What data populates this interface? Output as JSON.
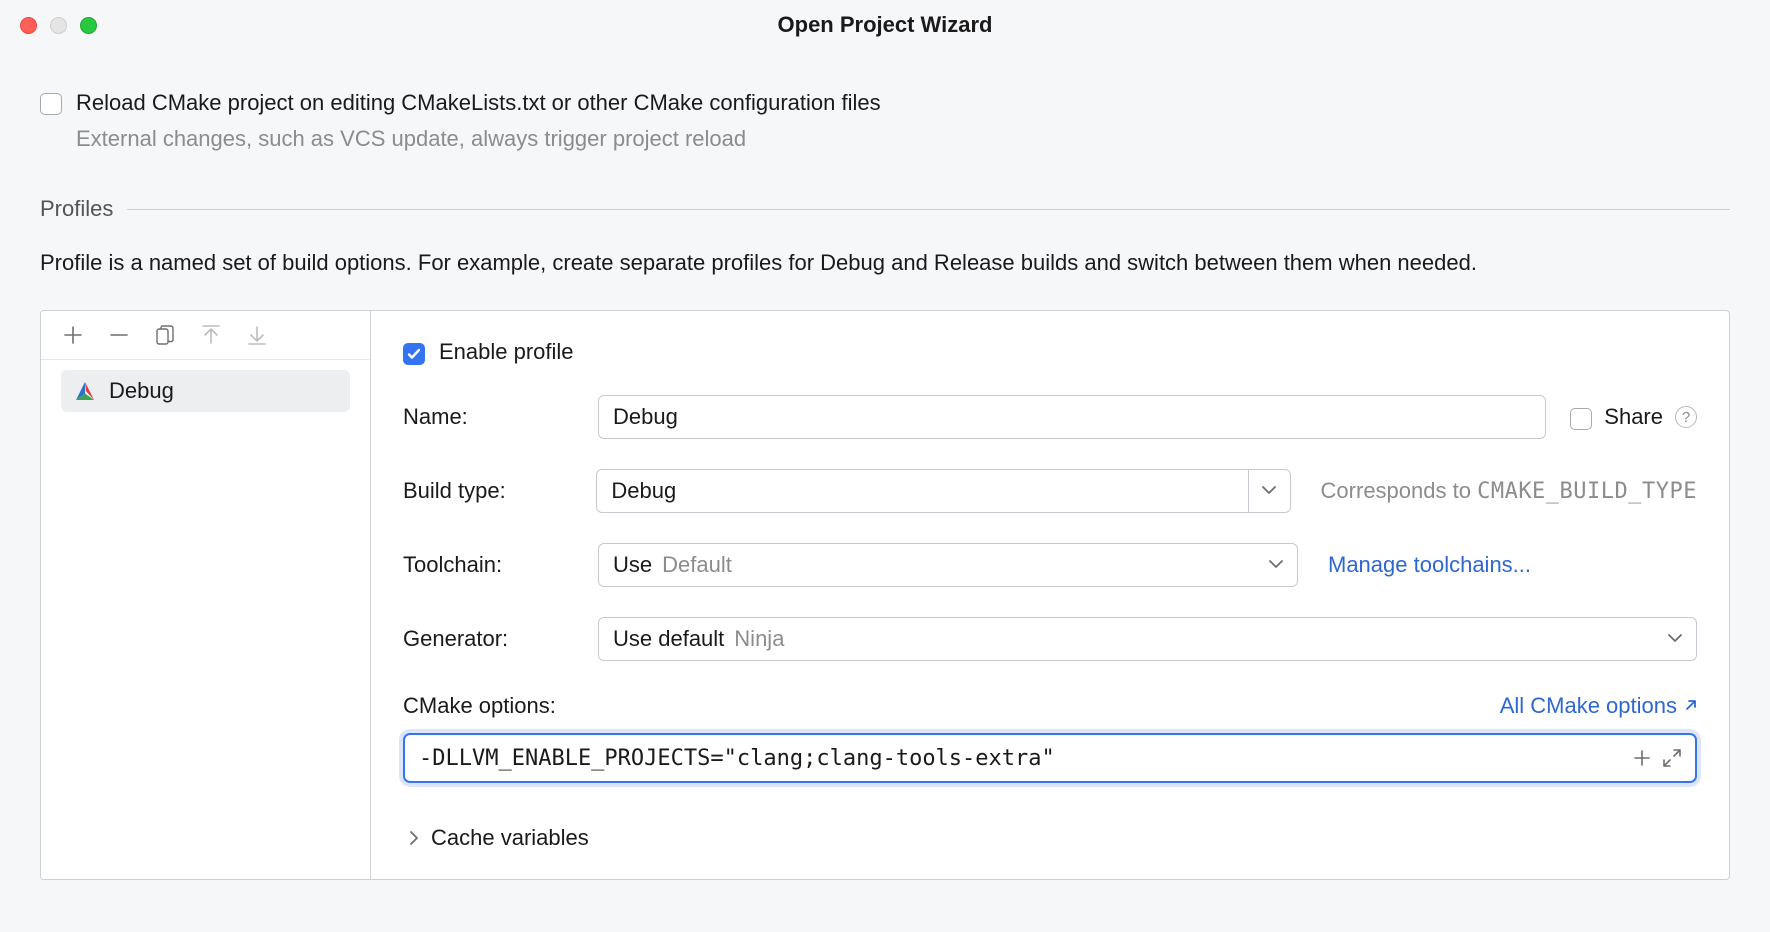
{
  "window": {
    "title": "Open Project Wizard"
  },
  "reload": {
    "checked": false,
    "label": "Reload CMake project on editing CMakeLists.txt or other CMake configuration files",
    "hint": "External changes, such as VCS update, always trigger project reload"
  },
  "profiles": {
    "header": "Profiles",
    "description": "Profile is a named set of build options. For example, create separate profiles for Debug and Release builds and switch between them when needed.",
    "items": [
      {
        "name": "Debug"
      }
    ],
    "detail": {
      "enable": {
        "checked": true,
        "label": "Enable profile"
      },
      "name": {
        "label": "Name:",
        "value": "Debug"
      },
      "share": {
        "label": "Share",
        "checked": false
      },
      "build_type": {
        "label": "Build type:",
        "value": "Debug",
        "hint_prefix": "Corresponds to ",
        "hint_code": "CMAKE_BUILD_TYPE"
      },
      "toolchain": {
        "label": "Toolchain:",
        "display_prefix": "Use",
        "display_hint": "Default",
        "link": "Manage toolchains..."
      },
      "generator": {
        "label": "Generator:",
        "display_prefix": "Use default",
        "display_hint": "Ninja"
      },
      "cmake_options": {
        "label": "CMake options:",
        "all_link": "All CMake options",
        "value": "-DLLVM_ENABLE_PROJECTS=\"clang;clang-tools-extra\""
      },
      "cache": {
        "label": "Cache variables"
      }
    }
  }
}
